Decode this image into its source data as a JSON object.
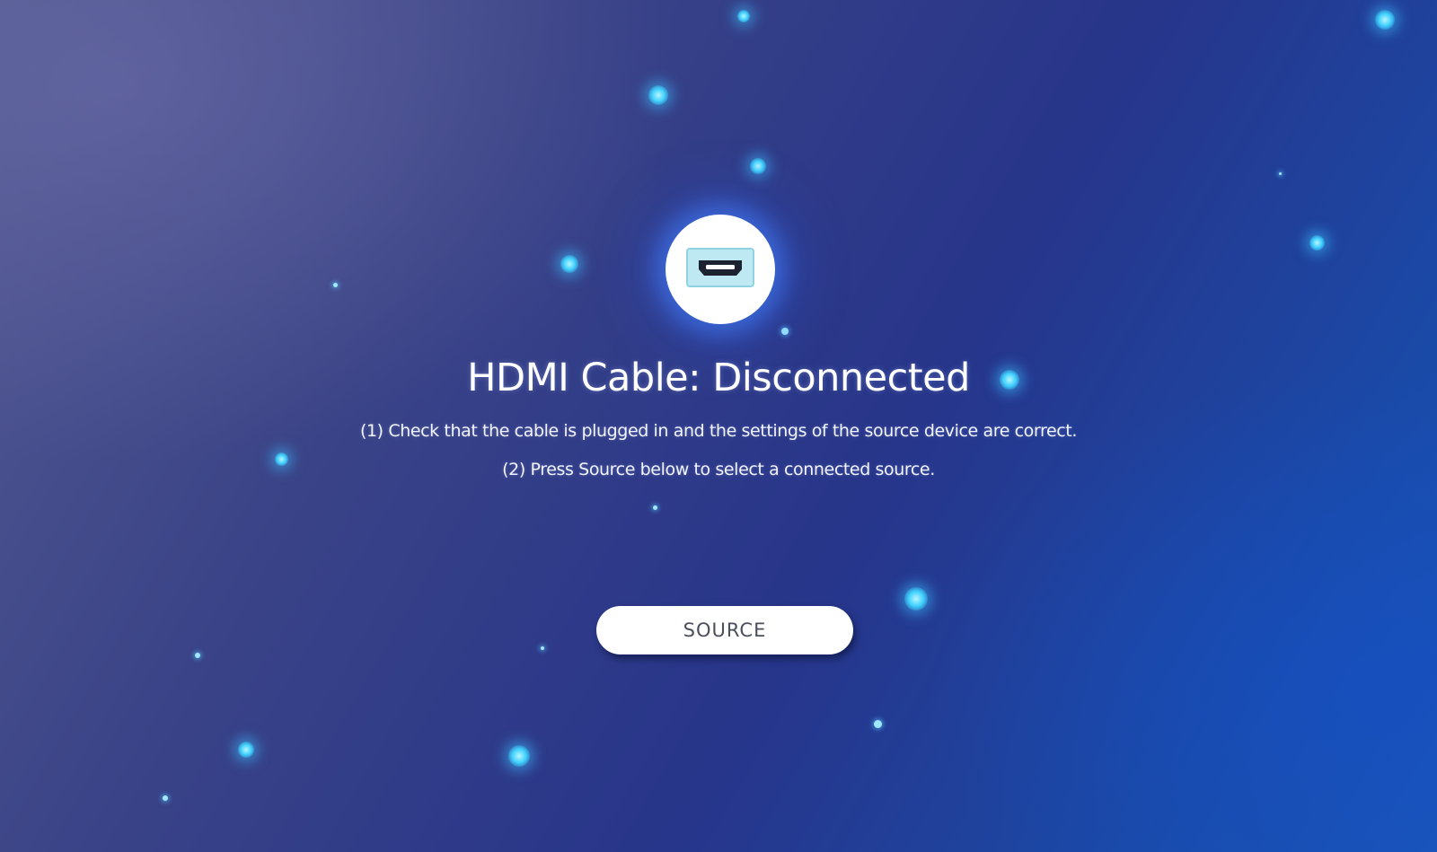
{
  "screen": {
    "title": "HDMI Cable: Disconnected",
    "instructions": [
      "(1) Check that the cable is plugged in and the settings of the source device are correct.",
      "(2) Press Source below to select a connected source."
    ],
    "source_button_label": "SOURCE"
  },
  "icons": {
    "connection": "hdmi-port-icon"
  },
  "colors": {
    "background_primary": "#2a3789",
    "background_accent": "#1a55b8",
    "particle": "#3fd0ff",
    "button_text": "#4a4f5c"
  }
}
